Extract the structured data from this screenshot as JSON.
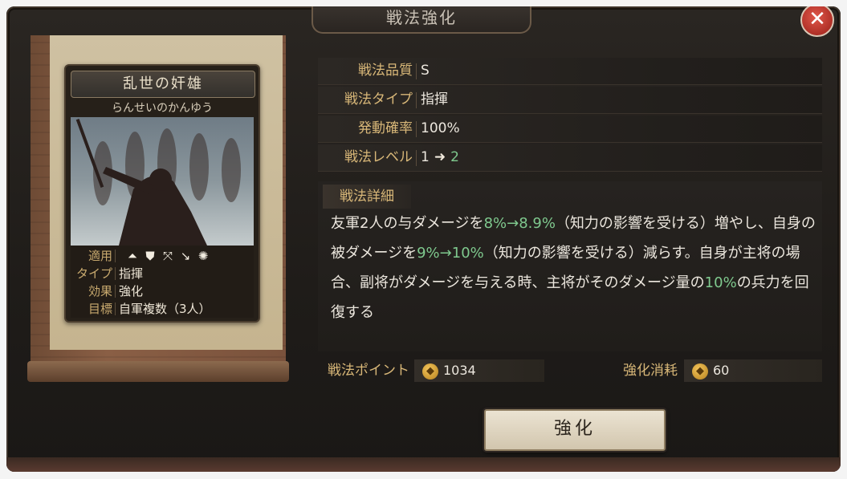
{
  "dialog": {
    "title": "戦法強化",
    "close_label": "✕"
  },
  "card": {
    "name": "乱世の奸雄",
    "reading": "らんせいのかんゆう",
    "stats": [
      {
        "key": "適用",
        "value": ""
      },
      {
        "key": "タイプ",
        "value": "指揮"
      },
      {
        "key": "効果",
        "value": "強化"
      },
      {
        "key": "目標",
        "value": "自軍複数（3人）"
      }
    ],
    "unit_icons": [
      "cavalry-icon",
      "shield-icon",
      "bow-icon",
      "spear-icon",
      "wheel-icon"
    ]
  },
  "info": {
    "quality_label": "戦法品質",
    "quality_value": "S",
    "type_label": "戦法タイプ",
    "type_value": "指揮",
    "rate_label": "発動確率",
    "rate_value": "100%",
    "level_label": "戦法レベル",
    "level_from": "1",
    "level_to": "2"
  },
  "detail": {
    "heading": "戦法詳細",
    "parts": {
      "p1": "友軍2人の与ダメージを",
      "g1": "8%→8.9%",
      "p2": "（知力の影響を受ける）増やし、自身の被ダメージを",
      "g2": "9%→10%",
      "p3": "（知力の影響を受ける）減らす。自身が主将の場合、副将がダメージを与える時、主将がそのダメージ量の",
      "g3": "10%",
      "p4": "の兵力を回復する"
    }
  },
  "costs": {
    "points_label": "戦法ポイント",
    "points_value": "1034",
    "consume_label": "強化消耗",
    "consume_value": "60"
  },
  "button": {
    "enhance_label": "強化"
  },
  "colors": {
    "accent_gold": "#d8b778",
    "highlight_green": "#7fc98e",
    "close_red": "#c2342a"
  }
}
